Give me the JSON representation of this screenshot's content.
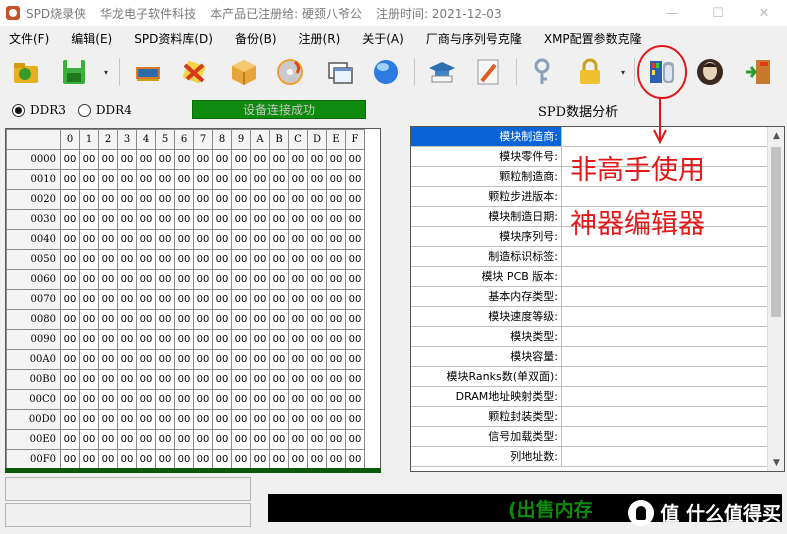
{
  "titlebar": {
    "app_name": "SPD烧录侠",
    "company": "华龙电子软件科技",
    "registration": "本产品已注册给: 硬颈八爷公",
    "reg_time": "注册时间: 2021-12-03",
    "minimize": "—",
    "maximize": "☐",
    "close": "✕"
  },
  "menu": [
    "文件(F)",
    "编辑(E)",
    "SPD资料库(D)",
    "备份(B)",
    "注册(R)",
    "关于(A)",
    "厂商与序列号克隆",
    "XMP配置参数克隆"
  ],
  "toolbar": {
    "dropdown_glyph": "▾",
    "icons": [
      "open-folder-icon",
      "save-disk-icon",
      "chip-icon",
      "eraser-icon",
      "package-box-icon",
      "cd-burn-icon",
      "window-copy-icon",
      "globe-icon",
      "graduation-cap-icon",
      "pen-edit-icon",
      "key-icon",
      "padlock-icon",
      "spd-editor-tool-icon",
      "avatar-icon",
      "exit-door-icon"
    ]
  },
  "ddr": {
    "options": [
      "DDR3",
      "DDR4"
    ],
    "selected": "DDR3"
  },
  "status_text": "设备连接成功",
  "spd_title": "SPD数据分析",
  "hex": {
    "col_headers": [
      "0",
      "1",
      "2",
      "3",
      "4",
      "5",
      "6",
      "7",
      "8",
      "9",
      "A",
      "B",
      "C",
      "D",
      "E",
      "F"
    ],
    "row_headers": [
      "0000",
      "0010",
      "0020",
      "0030",
      "0040",
      "0050",
      "0060",
      "0070",
      "0080",
      "0090",
      "00A0",
      "00B0",
      "00C0",
      "00D0",
      "00E0",
      "00F0"
    ],
    "cell_value": "00"
  },
  "spd_fields": [
    "模块制造商:",
    "模块零件号:",
    "颗粒制造商:",
    "颗粒步进版本:",
    "模块制造日期:",
    "模块序列号:",
    "制造标识标签:",
    "模块 PCB 版本:",
    "基本内存类型:",
    "模块速度等级:",
    "模块类型:",
    "模块容量:",
    "模块Ranks数(单双面):",
    "DRAM地址映射类型:",
    "颗粒封装类型:",
    "信号加载类型:",
    "列地址数:"
  ],
  "scroll": {
    "up": "▲",
    "down": "▼"
  },
  "annotation": {
    "line1": "非高手使用",
    "line2": "神器编辑器",
    "color": "#e01a1a"
  },
  "marquee_text": "(出售内存",
  "watermark": "值 什么值得买",
  "colors": {
    "status_green": "#0e8a0e",
    "selection_blue": "#0a64d8",
    "marquee_green": "#0b8a0b"
  }
}
